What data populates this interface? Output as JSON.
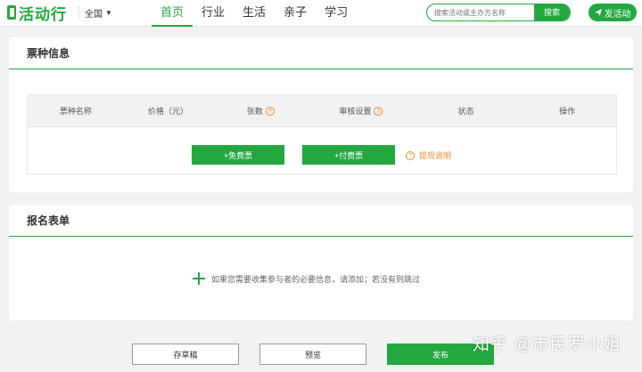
{
  "header": {
    "logo_text": "活动行",
    "region": "全国",
    "nav": [
      "首页",
      "行业",
      "生活",
      "亲子",
      "学习"
    ],
    "active_nav": 0,
    "search_placeholder": "搜索活动或主办方名称",
    "search_button": "搜索",
    "publish_button": "发活动"
  },
  "ticket_section": {
    "title": "票种信息",
    "columns": [
      "票种名称",
      "价格（元）",
      "张数",
      "审核设置",
      "状态",
      "操作"
    ],
    "free_button": "+免费票",
    "paid_button": "+付费票",
    "withdraw_link": "提现说明"
  },
  "form_section": {
    "title": "报名表单",
    "add_hint": "如果您需要收集参与者的必要信息，请添加；若没有则跳过"
  },
  "actions": {
    "draft": "存草稿",
    "preview": "预览",
    "publish": "发布"
  },
  "watermark": "知乎 @市民罗小姐",
  "colors": {
    "accent": "#23a83f",
    "warning": "#f08b32"
  }
}
